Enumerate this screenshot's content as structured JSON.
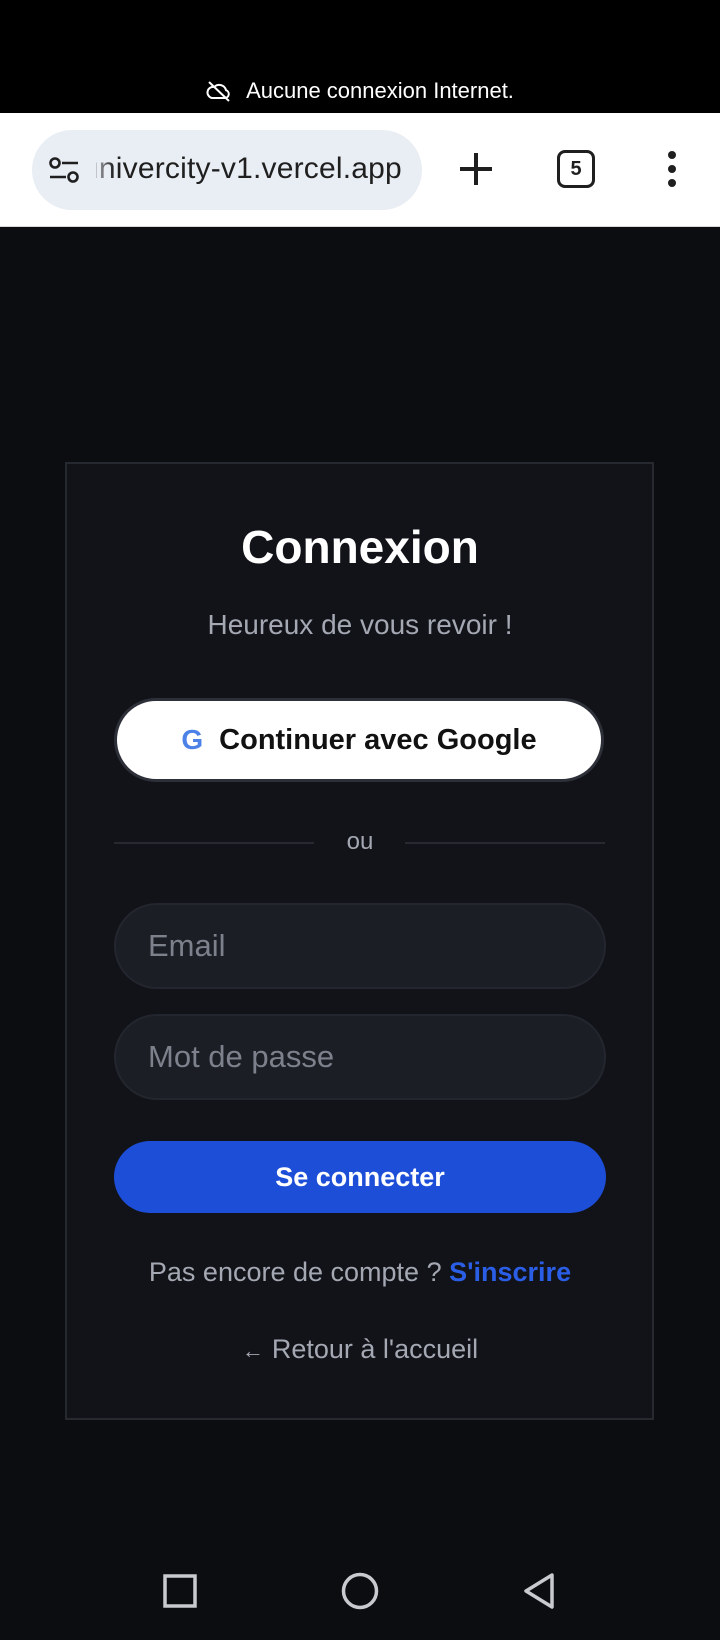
{
  "status_bar": {
    "offline_message": "Aucune connexion Internet.",
    "offline_icon": "cloud-off-icon"
  },
  "browser": {
    "url": "univercity-v1.vercel.app",
    "tab_count": "5",
    "icons": [
      "tune-icon",
      "plus-icon",
      "tabs-icon",
      "more-vertical-icon"
    ]
  },
  "login": {
    "title": "Connexion",
    "subtitle": "Heureux de vous revoir !",
    "google_letter": "G",
    "google_label": "Continuer avec Google",
    "divider": "ou",
    "email_placeholder": "Email",
    "password_placeholder": "Mot de passe",
    "submit_label": "Se connecter",
    "signup_prompt": "Pas encore de compte ? ",
    "signup_link": "S'inscrire",
    "back_arrow": "←",
    "back_label": "Retour à l'accueil"
  },
  "colors": {
    "background": "#0c0d11",
    "card": "#121318",
    "accent": "#1d4ed8",
    "link": "#2b5ee6"
  },
  "nav_bar": {
    "icons": [
      "recents-icon",
      "home-icon",
      "back-icon"
    ]
  }
}
